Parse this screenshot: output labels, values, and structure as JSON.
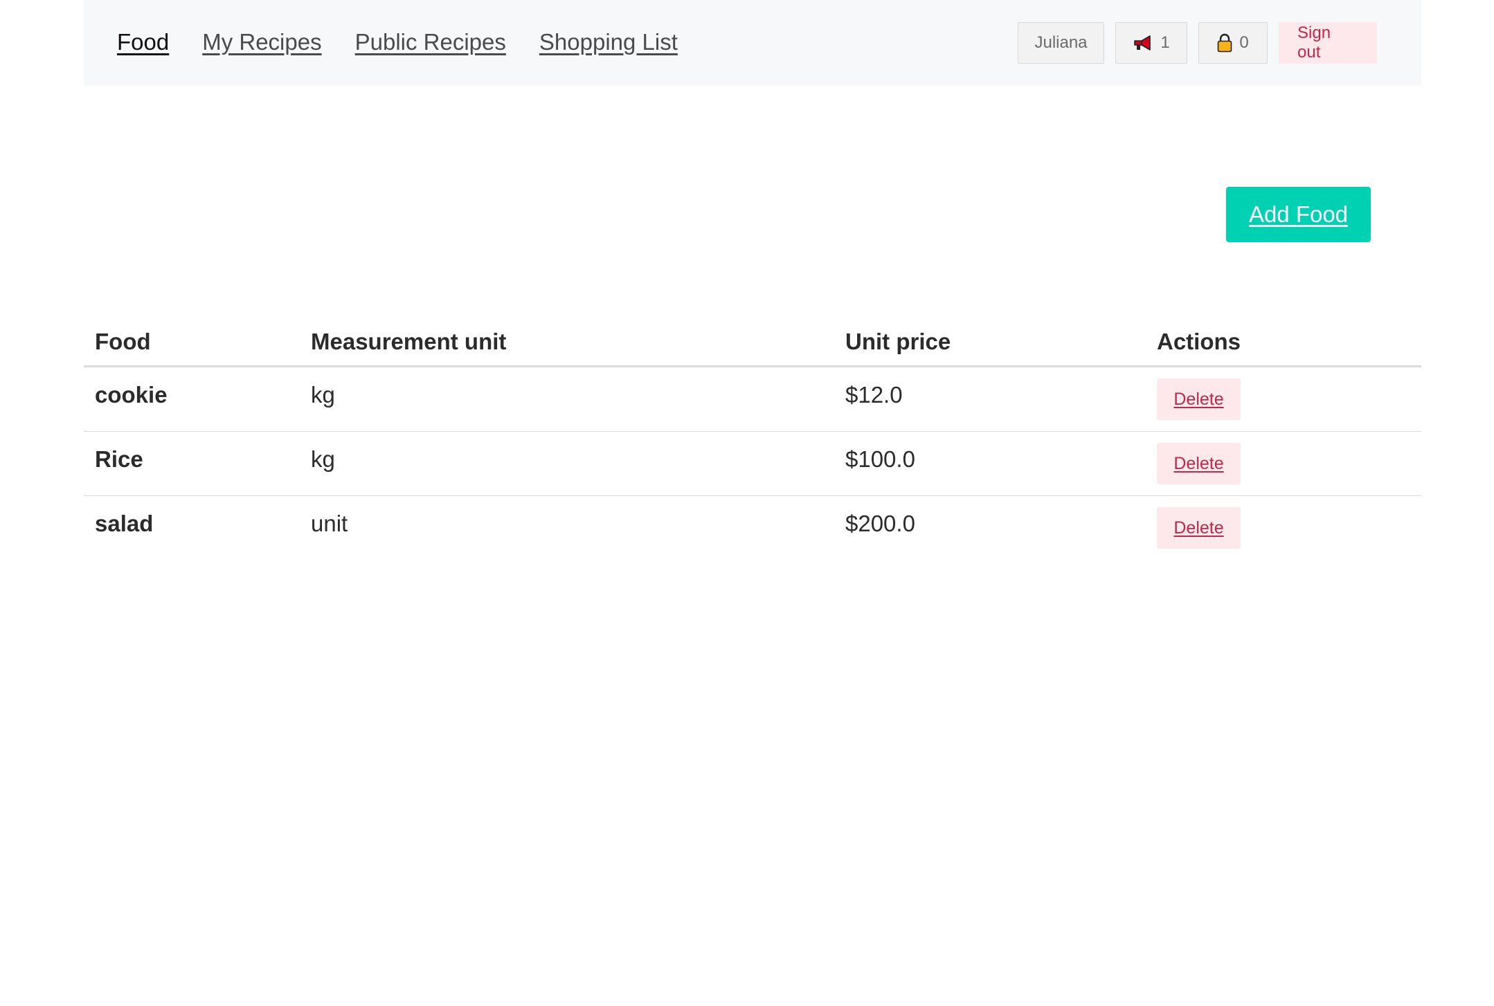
{
  "nav": {
    "links": [
      {
        "label": "Food",
        "active": true
      },
      {
        "label": "My Recipes",
        "active": false
      },
      {
        "label": "Public Recipes",
        "active": false
      },
      {
        "label": "Shopping List",
        "active": false
      }
    ],
    "user_name": "Juliana",
    "notifications_count": "1",
    "notifications_icon": "megaphone-icon",
    "lock_count": "0",
    "lock_icon": "lock-icon",
    "sign_out_label": "Sign out"
  },
  "actions": {
    "add_food_label": "Add Food"
  },
  "table": {
    "headers": {
      "food": "Food",
      "unit": "Measurement unit",
      "price": "Unit price",
      "actions": "Actions"
    },
    "rows": [
      {
        "food": "cookie",
        "unit": "kg",
        "price": "$12.0",
        "action": "Delete"
      },
      {
        "food": "Rice",
        "unit": "kg",
        "price": "$100.0",
        "action": "Delete"
      },
      {
        "food": "salad",
        "unit": "unit",
        "price": "$200.0",
        "action": "Delete"
      }
    ]
  },
  "colors": {
    "accent": "#00d1b2",
    "danger_text": "#c0284a",
    "danger_bg": "#fde8ec",
    "navbar_bg": "#f7f8f9"
  }
}
